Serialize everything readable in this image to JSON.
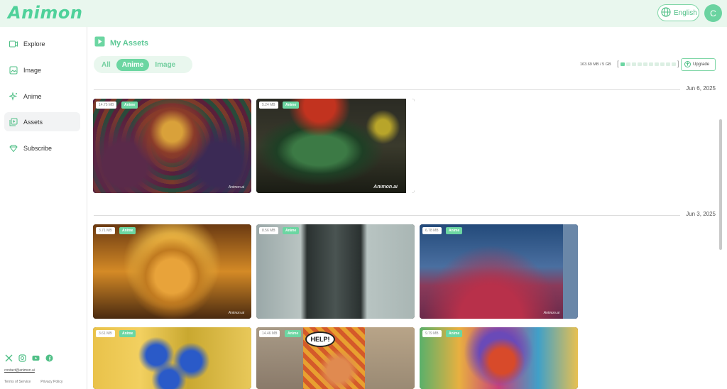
{
  "app": {
    "logo": "Animon"
  },
  "header": {
    "language": "English",
    "avatar_initial": "C"
  },
  "sidebar": {
    "items": [
      {
        "label": "Explore",
        "icon": "explore-icon"
      },
      {
        "label": "Image",
        "icon": "image-icon"
      },
      {
        "label": "Anime",
        "icon": "sparkle-icon"
      },
      {
        "label": "Assets",
        "icon": "assets-icon",
        "active": true
      },
      {
        "label": "Subscribe",
        "icon": "diamond-icon"
      }
    ],
    "socials": [
      "x-icon",
      "instagram-icon",
      "youtube-icon",
      "facebook-icon"
    ],
    "contact": "contact@animon.ai",
    "terms": "Terms of Service",
    "privacy": "Privacy Policy"
  },
  "main": {
    "title": "My Assets",
    "filters": [
      {
        "label": "All",
        "active": false
      },
      {
        "label": "Anime",
        "active": true
      },
      {
        "label": "Image",
        "active": false
      }
    ],
    "storage": {
      "text": "163.69 MB / 5 GB",
      "used_fraction": 0.03
    },
    "upgrade_label": "Upgrade",
    "groups": [
      {
        "date": "Jun 6, 2025",
        "cards": [
          {
            "size": "14.75 MB",
            "type": "Anime",
            "watermark": "Animon.ai"
          },
          {
            "size": "5.24 MB",
            "type": "Anime",
            "watermark": "Animon.ai"
          }
        ]
      },
      {
        "date": "Jun 3, 2025",
        "cards": [
          {
            "size": "3.71 MB",
            "type": "Anime",
            "watermark": "Animon.ai"
          },
          {
            "size": "8.56 MB",
            "type": "Anime",
            "watermark": ""
          },
          {
            "size": "6.78 MB",
            "type": "Anime",
            "watermark": "Animon.ai"
          },
          {
            "size": "3.61 MB",
            "type": "Anime",
            "watermark": ""
          },
          {
            "size": "14.46 MB",
            "type": "Anime",
            "watermark": ""
          },
          {
            "size": "9.79 MB",
            "type": "Anime",
            "watermark": ""
          }
        ]
      }
    ]
  },
  "colors": {
    "accent": "#6cd6a2",
    "header_bg": "#e9f7ee"
  }
}
